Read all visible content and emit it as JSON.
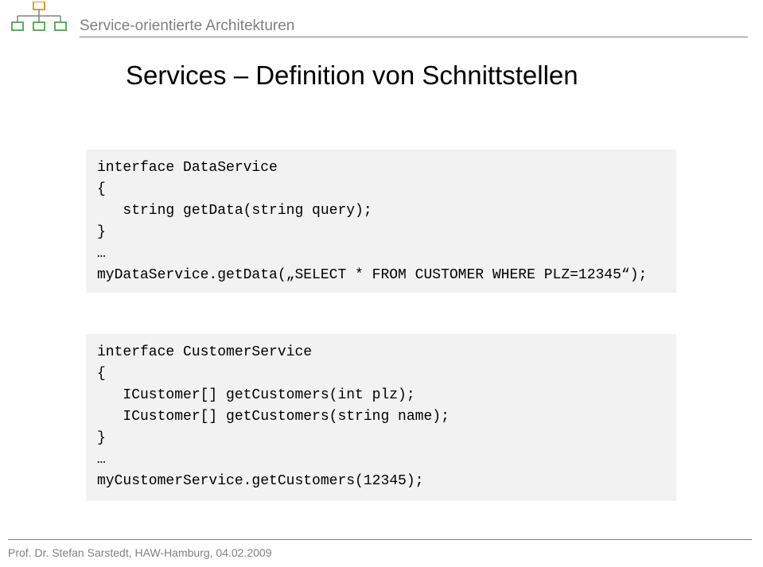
{
  "header": {
    "course_title": "Service-orientierte Architekturen"
  },
  "title": "Services – Definition von Schnittstellen",
  "code": {
    "block1": "interface DataService\n{\n   string getData(string query);\n}\n…\nmyDataService.getData(„SELECT * FROM CUSTOMER WHERE PLZ=12345“);",
    "block2": "interface CustomerService\n{\n   ICustomer[] getCustomers(int plz);\n   ICustomer[] getCustomers(string name);\n}\n…\nmyCustomerService.getCustomers(12345);"
  },
  "footer": {
    "text": "Prof. Dr. Stefan Sarstedt, HAW-Hamburg, 04.02.2009"
  }
}
